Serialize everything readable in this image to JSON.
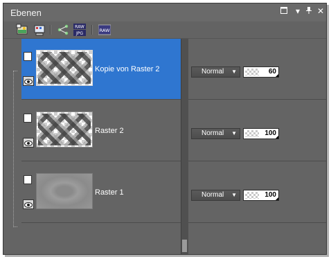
{
  "window": {
    "title": "Ebenen"
  },
  "titlebar_buttons": {
    "restore_icon": "restore-icon",
    "menu_icon": "dropdown-icon",
    "pin_icon": "pin-icon",
    "close_icon": "close-icon"
  },
  "toolbar": {
    "tools": [
      "new-raster-layer-icon",
      "new-vector-layer-icon",
      "link-layers-icon",
      "raw-jpg-icon",
      "raw-icon"
    ]
  },
  "layers": [
    {
      "name": "Kopie von Raster 2",
      "blend_mode": "Normal",
      "opacity": "60",
      "selected": true
    },
    {
      "name": "Raster 2",
      "blend_mode": "Normal",
      "opacity": "100",
      "selected": false
    },
    {
      "name": "Raster 1",
      "blend_mode": "Normal",
      "opacity": "100",
      "selected": false
    }
  ],
  "colors": {
    "panel_bg": "#636363",
    "selection": "#2f76d0"
  }
}
